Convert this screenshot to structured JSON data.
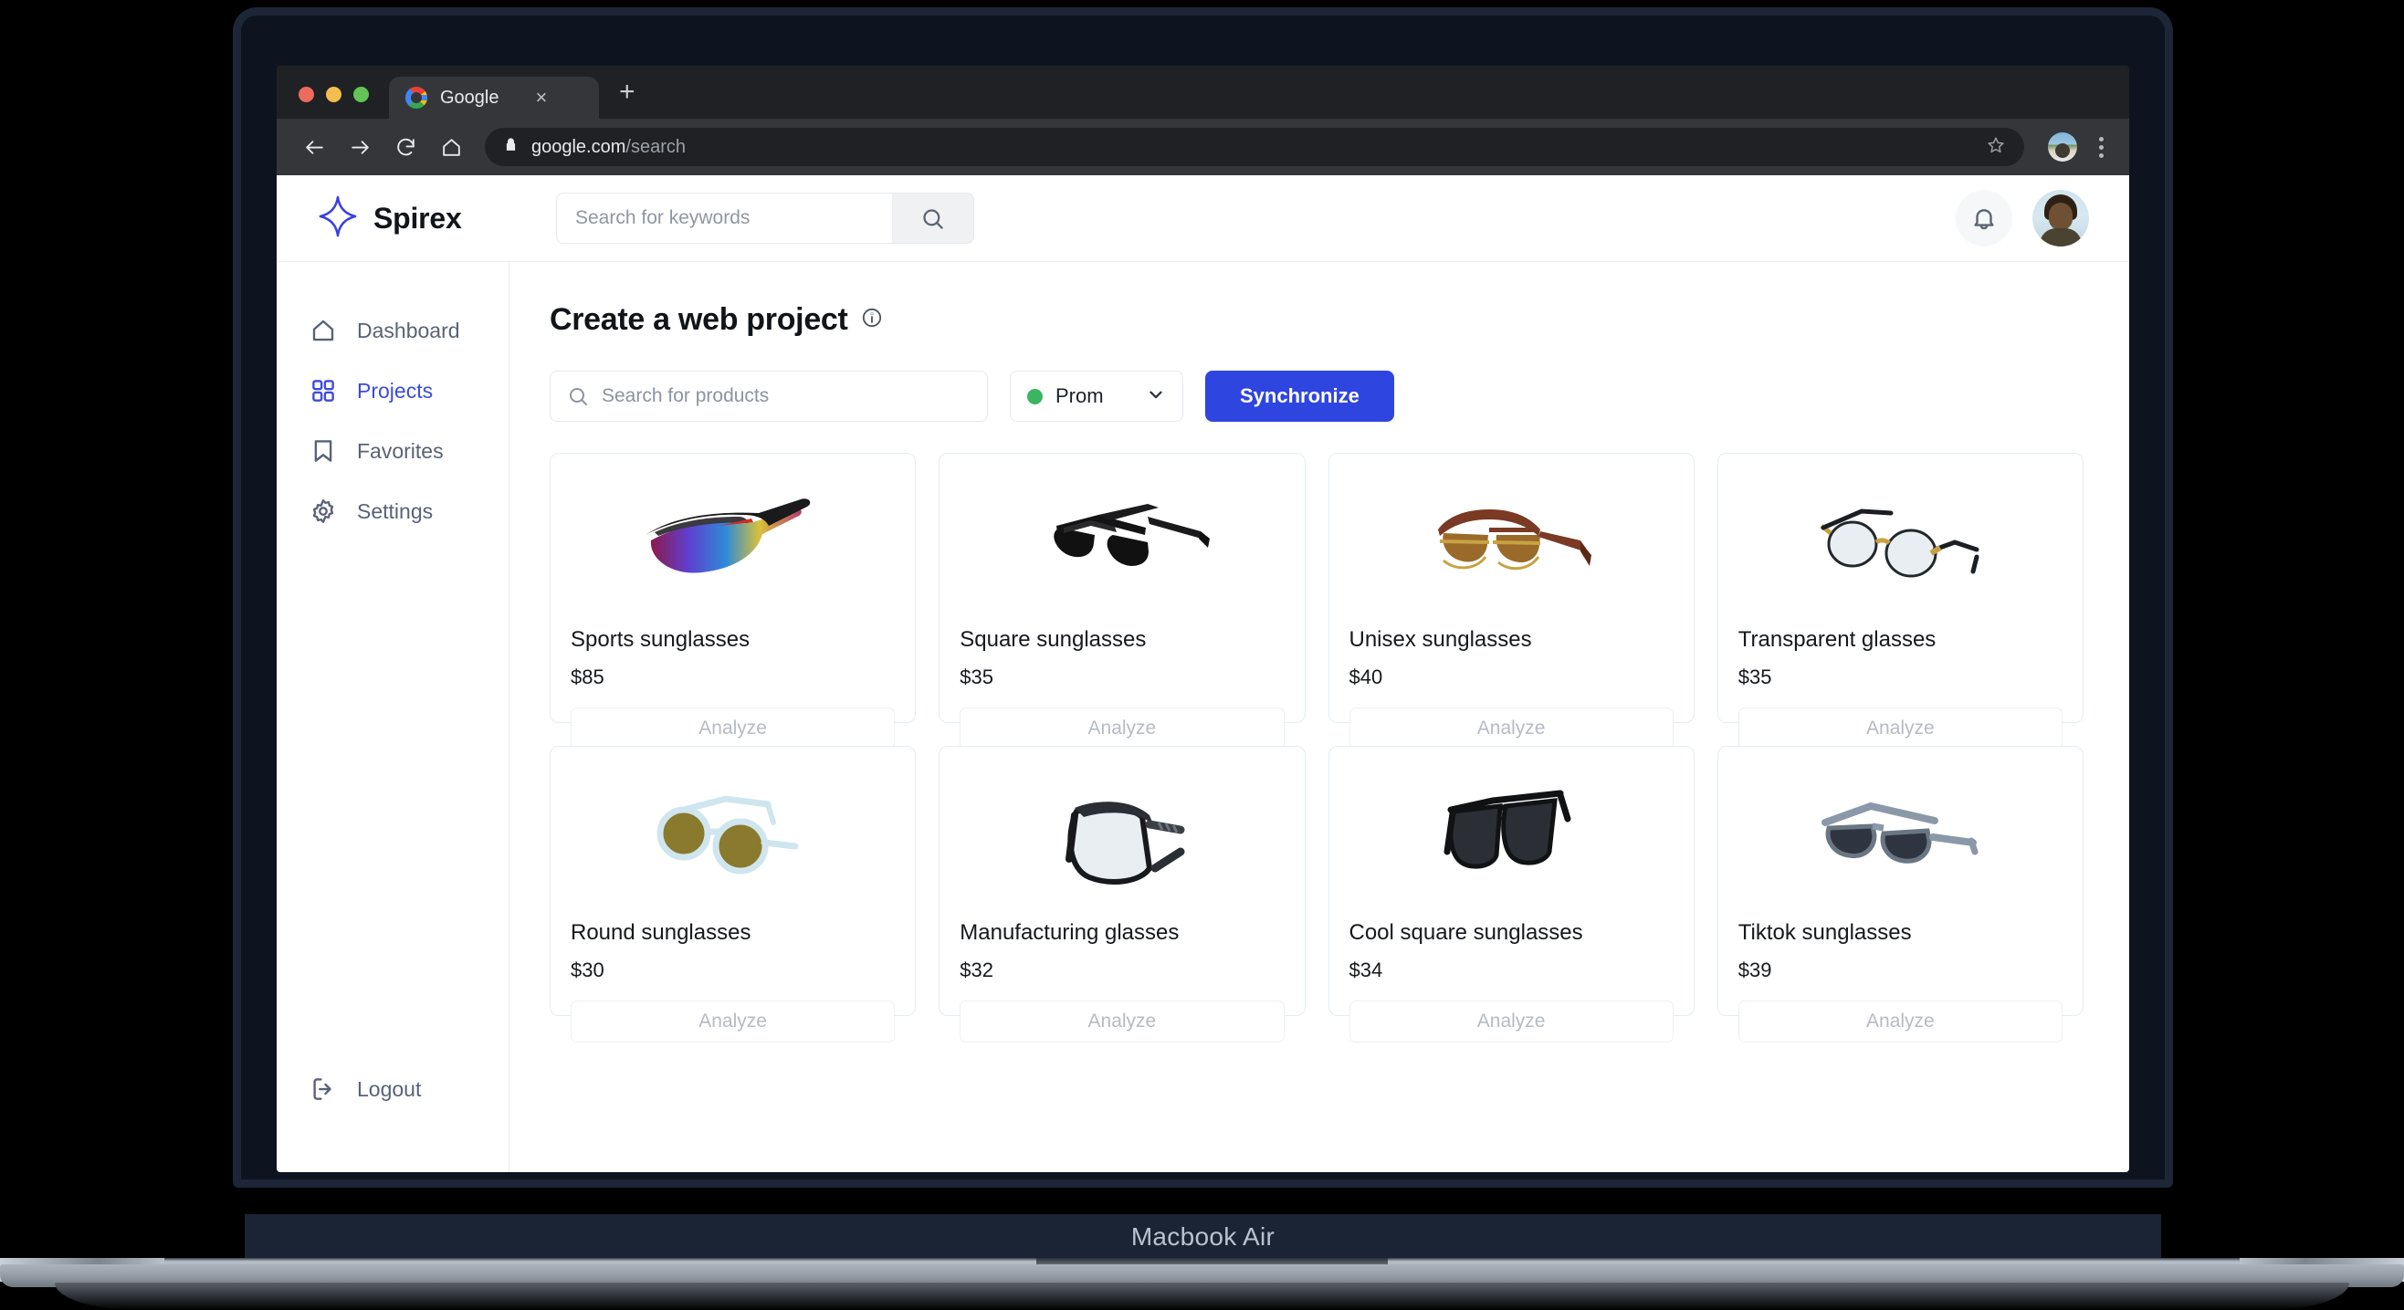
{
  "device": {
    "model_label": "Macbook Air"
  },
  "browser": {
    "tab": {
      "title": "Google",
      "favicon": "google-icon",
      "close": "×"
    },
    "new_tab": "+",
    "url_host": "google.com",
    "url_path": "/search",
    "icons": [
      "back-icon",
      "forward-icon",
      "reload-icon",
      "home-icon",
      "lock-icon",
      "star-icon",
      "chrome-menu-icon"
    ]
  },
  "app": {
    "brand": {
      "name": "Spirex",
      "logo": "sparkle-star-icon"
    },
    "header_search": {
      "placeholder": "Search for keywords",
      "value": "",
      "button_icon": "search-icon"
    },
    "header_actions": {
      "notifications_icon": "bell-icon",
      "avatar": "user-avatar"
    }
  },
  "sidebar": {
    "items": [
      {
        "label": "Dashboard",
        "icon": "home-icon",
        "active": false
      },
      {
        "label": "Projects",
        "icon": "grid-icon",
        "active": true
      },
      {
        "label": "Favorites",
        "icon": "bookmark-icon",
        "active": false
      },
      {
        "label": "Settings",
        "icon": "gear-icon",
        "active": false
      }
    ],
    "logout": {
      "label": "Logout",
      "icon": "logout-icon"
    }
  },
  "main": {
    "title": "Create a web project",
    "title_info_icon": "info-circle-icon",
    "product_search": {
      "placeholder": "Search for products",
      "value": "",
      "icon": "search-icon"
    },
    "store_select": {
      "value": "Prom",
      "status_color": "#3ab662",
      "chevron_icon": "chevron-down-icon"
    },
    "sync_button": {
      "label": "Synchronize",
      "color": "#2f45e0"
    },
    "analyze_label": "Analyze",
    "products": [
      {
        "name": "Sports sunglasses",
        "price": "$85",
        "image": "sports-sunglasses-image"
      },
      {
        "name": "Square sunglasses",
        "price": "$35",
        "image": "square-sunglasses-image"
      },
      {
        "name": "Unisex sunglasses",
        "price": "$40",
        "image": "unisex-sunglasses-image"
      },
      {
        "name": "Transparent glasses",
        "price": "$35",
        "image": "transparent-glasses-image"
      },
      {
        "name": "Round sunglasses",
        "price": "$30",
        "image": "round-sunglasses-image"
      },
      {
        "name": "Manufacturing glasses",
        "price": "$32",
        "image": "manufacturing-glasses-image"
      },
      {
        "name": "Cool square sunglasses",
        "price": "$34",
        "image": "cool-square-sunglasses-image"
      },
      {
        "name": "Tiktok sunglasses",
        "price": "$39",
        "image": "tiktok-sunglasses-image"
      }
    ]
  },
  "colors": {
    "accent": "#2f45e0",
    "active_nav": "#3b4bdb",
    "status_green": "#3ab662",
    "card_border": "#e4edf3"
  }
}
